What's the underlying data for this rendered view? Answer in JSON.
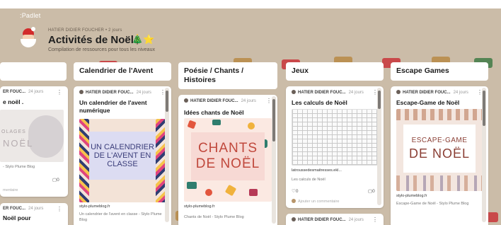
{
  "app": {
    "brand": "Padlet"
  },
  "board": {
    "owner": "HATIER DIDIER FOUCHER • 2 jours",
    "title": "Activités de Noël",
    "title_emoji": "🎄⭐",
    "subtitle": "Compilation de ressources pour tous les niveaux"
  },
  "columns": [
    {
      "label": ""
    },
    {
      "label": "Calendrier de l'Avent"
    },
    {
      "label": "Poésie / Chants / Histoires"
    },
    {
      "label": "Jeux"
    },
    {
      "label": "Escape Games"
    }
  ],
  "cards": {
    "c0_top": {
      "author": "ER FOUC...",
      "when": "24 jours",
      "title": "e noël .",
      "img_line1": "OLAGES",
      "img_line2": "NOËL",
      "meta": "- Stylo Plume Blog",
      "comments": "0",
      "comment_placeholder": "mentaire"
    },
    "c0_bottom": {
      "author": "ER FOUC...",
      "when": "24 jours",
      "title": "Noël pour"
    },
    "c1": {
      "author": "HATIER DIDIER FOUC...",
      "when": "24 jours",
      "title": "Un calendrier de l'avent numérique",
      "banner": "UN CALENDRIER DE L'AVENT EN CLASSE",
      "domain": "stylo-plumeblog.fr",
      "meta": "Un calendrier de l'avent en classe - Stylo Plume Blog"
    },
    "c2": {
      "author": "HATIER DIDIER FOUC...",
      "when": "24 jours",
      "title": "Idées chants de Noël",
      "banner_line1": "CHANTS",
      "banner_line2": "DE NOËL",
      "domain": "stylo-plumeblog.fr",
      "meta": "Chants de Noël - Stylo Plume Blog"
    },
    "c3": {
      "author": "HATIER DIDIER FOUC...",
      "when": "24 jours",
      "title": "Les calculs de Noël",
      "domain": "latroussedesmaitresses.ekl...",
      "meta": "Les calculs de Noël",
      "likes": "0",
      "comments": "0",
      "comment_placeholder": "Ajouter un commentaire"
    },
    "c3_bottom": {
      "author": "HATIER DIDIER FOUC...",
      "when": "24 jours"
    },
    "c4": {
      "author": "HATIER DIDIER FOUC...",
      "when": "24 jours",
      "title": "Escape-Game de Noël",
      "banner_line1": "ESCAPE-GAME",
      "banner_line2": "DE NOËL",
      "domain": "stylo-plumeblog.fr",
      "meta": "Escape-Game de Noël - Stylo Plume Blog"
    }
  },
  "icons": {
    "menu": "⋮",
    "comment": "▢",
    "heart": "♡",
    "avatar": "santa-avatar"
  },
  "colors": {
    "background": "#cbbca8",
    "card": "#ffffff",
    "accent_red": "#c9353a",
    "banner_pink": "#f7d9d4",
    "banner_lilac": "#dcdcf2"
  }
}
